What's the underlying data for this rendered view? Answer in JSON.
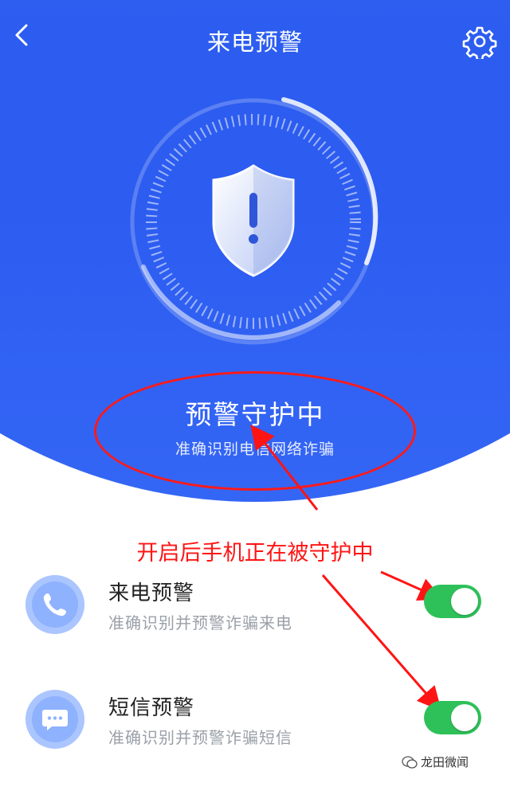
{
  "header": {
    "title": "来电预警",
    "back_icon": "chevron-left-icon",
    "settings_icon": "gear-icon"
  },
  "status": {
    "title": "预警守护中",
    "subtitle": "准确识别电信网络诈骗",
    "icon": "shield-alert-icon"
  },
  "annotation": {
    "text": "开启后手机正在被守护中",
    "color": "#ff1414"
  },
  "settings": [
    {
      "name": "来电预警",
      "desc": "准确识别并预警诈骗来电",
      "icon": "phone-icon",
      "enabled": true
    },
    {
      "name": "短信预警",
      "desc": "准确识别并预警诈骗短信",
      "icon": "message-icon",
      "enabled": true
    }
  ],
  "watermark": {
    "text": "龙田微闻"
  },
  "colors": {
    "brand_blue": "#2f62ee",
    "toggle_on": "#2ec15a",
    "annotation_red": "#ff1414"
  }
}
